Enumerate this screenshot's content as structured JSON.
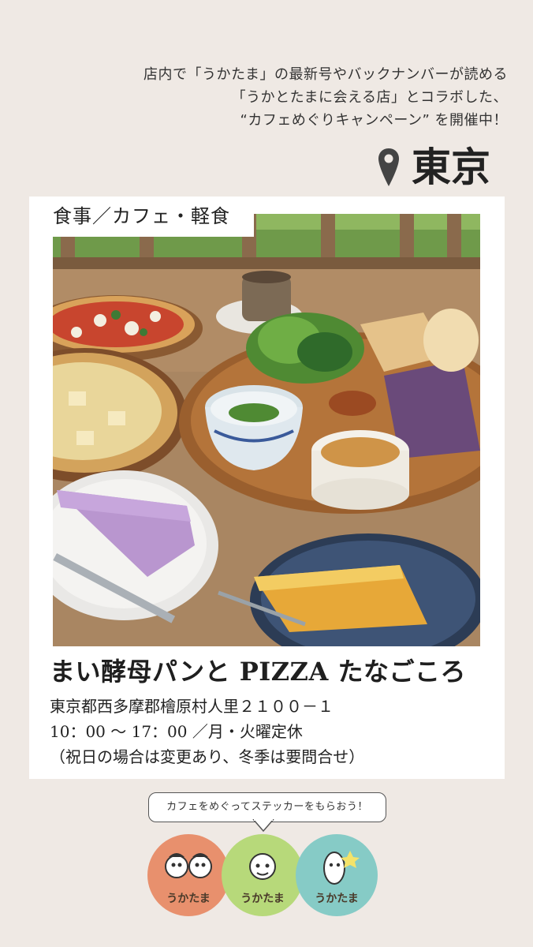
{
  "intro": {
    "line1": "店内で「うかたま」の最新号やバックナンバーが読める",
    "line2": "「うかとたまに会える店」とコラボした、",
    "line3": "“カフェめぐりキャンペーン” を開催中！"
  },
  "location": {
    "icon": "map-pin-icon",
    "city": "東京"
  },
  "card": {
    "category": "食事／カフェ・軽食",
    "shop_name": "まい酵母パンと PIZZA たなごころ",
    "address": "東京都西多摩郡檜原村人里２１００－１",
    "hours": "10：00 ～ 17：00 ／月・火曜定休",
    "note": "（祝日の場合は変更あり、冬季は要問合せ）"
  },
  "campaign": {
    "bubble": "カフェをめぐってステッカーをもらおう！",
    "stickers": [
      {
        "label": "うかたま",
        "color": "#e8906d"
      },
      {
        "label": "うかたま",
        "color": "#b7d97a"
      },
      {
        "label": "うかたま",
        "color": "#86cbc6"
      }
    ]
  },
  "colors": {
    "background": "#efe9e4",
    "card": "#ffffff",
    "pin": "#444444"
  }
}
